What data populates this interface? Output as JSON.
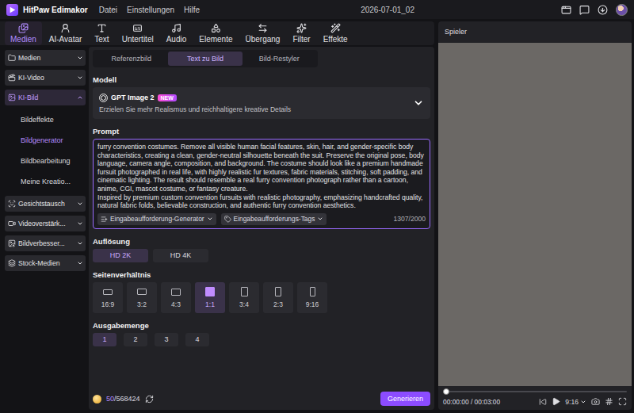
{
  "app": {
    "title": "HitPaw Edimakor",
    "menu": [
      "Datei",
      "Einstellungen",
      "Hilfe"
    ],
    "project": "2026-07-01_02"
  },
  "toolbar": [
    {
      "label": "Medien",
      "selected": true
    },
    {
      "label": "AI-Avatar",
      "selected": false
    },
    {
      "label": "Text",
      "selected": false
    },
    {
      "label": "Untertitel",
      "selected": false
    },
    {
      "label": "Audio",
      "selected": false
    },
    {
      "label": "Elemente",
      "selected": false
    },
    {
      "label": "Übergang",
      "selected": false
    },
    {
      "label": "Filter",
      "selected": false
    },
    {
      "label": "Effekte",
      "selected": false
    }
  ],
  "sidebar": [
    {
      "label": "Medien",
      "expanded": false,
      "selected": false
    },
    {
      "label": "KI-Video",
      "expanded": false,
      "selected": false
    },
    {
      "label": "KI-Bild",
      "expanded": true,
      "selected": true,
      "children": [
        {
          "label": "Bildeffekte",
          "selected": false
        },
        {
          "label": "Bildgenerator",
          "selected": true
        },
        {
          "label": "Bildbearbeitung",
          "selected": false
        },
        {
          "label": "Meine Kreatio...",
          "selected": false
        }
      ]
    },
    {
      "label": "Gesichtstausch",
      "expanded": false,
      "selected": false
    },
    {
      "label": "Videoverstärk...",
      "expanded": false,
      "selected": false
    },
    {
      "label": "Bildverbesser...",
      "expanded": false,
      "selected": false
    },
    {
      "label": "Stock-Medien",
      "expanded": false,
      "selected": false
    }
  ],
  "mode_tabs": [
    {
      "label": "Referenzbild",
      "selected": false
    },
    {
      "label": "Text zu Bild",
      "selected": true
    },
    {
      "label": "Bild-Restyler",
      "selected": false
    }
  ],
  "model": {
    "heading": "Modell",
    "name": "GPT Image 2",
    "badge": "NEW",
    "description": "Erzielen Sie mehr Realismus und reichhaltigere kreative Details"
  },
  "prompt": {
    "heading": "Prompt",
    "text": "furry convention costumes. Remove all visible human facial features, skin, hair, and gender-specific body characteristics, creating a clean, gender-neutral silhouette beneath the suit. Preserve the original pose, body language, camera angle, composition, and background. The costume should look like a premium handmade fursuit photographed in real life, with highly realistic fur textures, fabric materials, stitching, soft padding, and cinematic lighting. The result should resemble a real furry convention photograph rather than a cartoon, anime, CGI, mascot costume, or fantasy creature.\nInspired by premium custom convention fursuits with realistic photography, emphasizing handcrafted quality, natural fabric folds, believable construction, and authentic furry convention aesthetics.",
    "generator": "Eingabeaufforderung-Generator",
    "tags": "Eingabeaufforderungs-Tags",
    "count": "1307/2000"
  },
  "resolution": {
    "heading": "Auflösung",
    "options": [
      {
        "label": "HD 2K",
        "selected": true
      },
      {
        "label": "HD 4K",
        "selected": false
      }
    ]
  },
  "aspect": {
    "heading": "Seitenverhältnis",
    "options": [
      {
        "label": "16:9",
        "selected": false
      },
      {
        "label": "3:2",
        "selected": false
      },
      {
        "label": "4:3",
        "selected": false
      },
      {
        "label": "1:1",
        "selected": true
      },
      {
        "label": "3:4",
        "selected": false
      },
      {
        "label": "2:3",
        "selected": false
      },
      {
        "label": "9:16",
        "selected": false
      }
    ]
  },
  "quantity": {
    "heading": "Ausgabemenge",
    "options": [
      {
        "label": "1",
        "selected": true
      },
      {
        "label": "2",
        "selected": false
      },
      {
        "label": "3",
        "selected": false
      },
      {
        "label": "4",
        "selected": false
      }
    ]
  },
  "credits": {
    "used": "50",
    "total": "/568424"
  },
  "generate": "Generieren",
  "player": {
    "title": "Spieler",
    "time": "00:00:00 / 00:03:00",
    "ratio": "9:16",
    "level": 0
  }
}
